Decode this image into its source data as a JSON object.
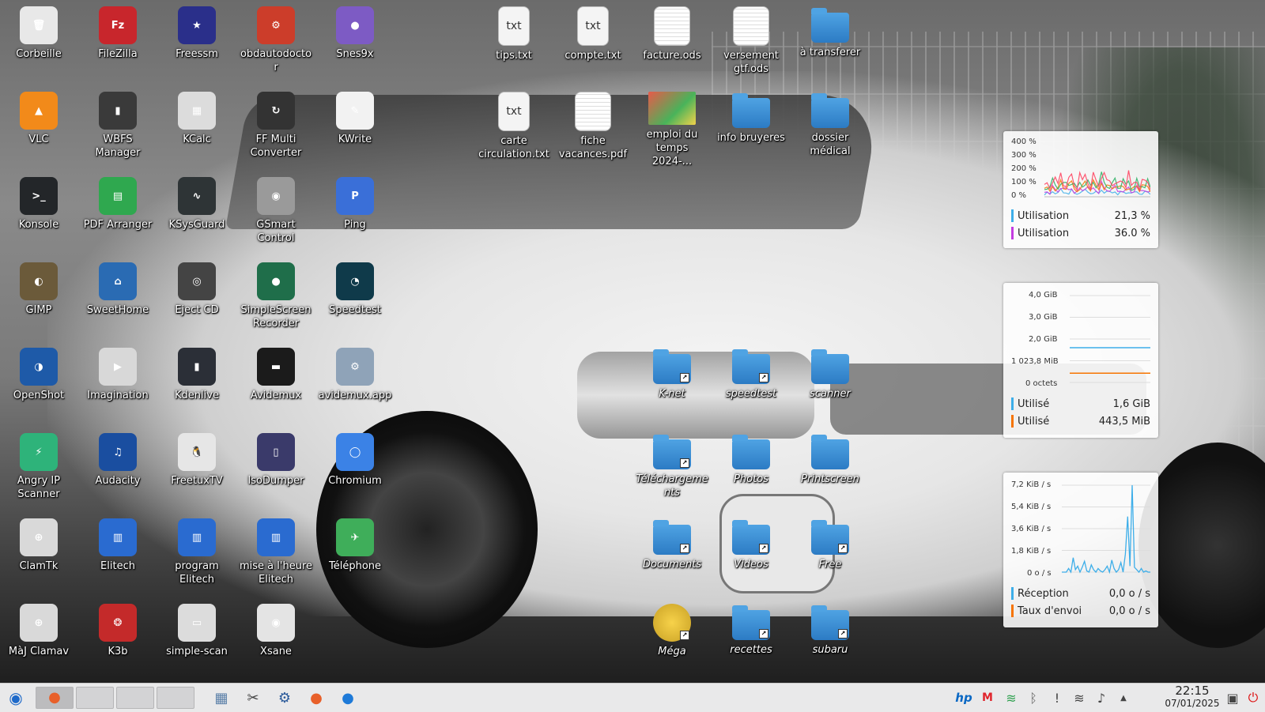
{
  "desktop": {
    "icons": [
      {
        "id": "corbeille",
        "label": "Corbeille",
        "icon": "trash-icon",
        "color": "#e8e8e8",
        "glyph": "🗑"
      },
      {
        "id": "filezilla",
        "label": "FileZilla",
        "icon": "filezilla-icon",
        "color": "#c8262c",
        "glyph": "Fz"
      },
      {
        "id": "freessm",
        "label": "Freessm",
        "icon": "freessm-icon",
        "color": "#2a2f8a",
        "glyph": "★"
      },
      {
        "id": "obdautodoctor",
        "label": "obdautodoctor",
        "icon": "engine-icon",
        "color": "#cc3d2a",
        "glyph": "⚙"
      },
      {
        "id": "snes9x",
        "label": "Snes9x",
        "icon": "gamepad-icon",
        "color": "#7d5bc4",
        "glyph": "●"
      },
      {
        "id": "vlc",
        "label": "VLC",
        "icon": "vlc-cone-icon",
        "color": "#f28a1a",
        "glyph": "▲"
      },
      {
        "id": "wbfs",
        "label": "WBFS Manager",
        "icon": "wbfs-icon",
        "color": "#3a3a3a",
        "glyph": "▮"
      },
      {
        "id": "kcalc",
        "label": "KCalc",
        "icon": "calculator-icon",
        "color": "#dcdcdc",
        "glyph": "▦"
      },
      {
        "id": "ffmulti",
        "label": "FF Multi Converter",
        "icon": "converter-icon",
        "color": "#333",
        "glyph": "↻"
      },
      {
        "id": "kwrite",
        "label": "KWrite",
        "icon": "pencil-icon",
        "color": "#f2f2f2",
        "glyph": "✎"
      },
      {
        "id": "konsole",
        "label": "Konsole",
        "icon": "terminal-icon",
        "color": "#232629",
        "glyph": ">_"
      },
      {
        "id": "pdfarranger",
        "label": "PDF Arranger",
        "icon": "pdf-arranger-icon",
        "color": "#2fa84f",
        "glyph": "▤"
      },
      {
        "id": "ksysguard",
        "label": "KSysGuard",
        "icon": "monitor-icon",
        "color": "#2e3436",
        "glyph": "∿"
      },
      {
        "id": "gsmart",
        "label": "GSmart Control",
        "icon": "hard-drive-icon",
        "color": "#9a9a9a",
        "glyph": "◉"
      },
      {
        "id": "ping",
        "label": "Ping",
        "icon": "ping-icon",
        "color": "#3a6fd8",
        "glyph": "P"
      },
      {
        "id": "gimp",
        "label": "GIMP",
        "icon": "gimp-icon",
        "color": "#6b5a3a",
        "glyph": "◐"
      },
      {
        "id": "sweethome",
        "label": "SweetHome",
        "icon": "house-icon",
        "color": "#2a6bb3",
        "glyph": "⌂"
      },
      {
        "id": "ejectcd",
        "label": "Eject CD",
        "icon": "cd-icon",
        "color": "#444",
        "glyph": "◎"
      },
      {
        "id": "simplescreen",
        "label": "SimpleScreen Recorder",
        "icon": "recorder-icon",
        "color": "#1f6e4a",
        "glyph": "●"
      },
      {
        "id": "speedtest",
        "label": "Speedtest",
        "icon": "speedometer-icon",
        "color": "#0f3a4a",
        "glyph": "◔"
      },
      {
        "id": "openshot",
        "label": "OpenShot",
        "icon": "openshot-icon",
        "color": "#1e5aa8",
        "glyph": "◑"
      },
      {
        "id": "imagination",
        "label": "Imagination",
        "icon": "imagination-icon",
        "color": "#d8d8d8",
        "glyph": "▶"
      },
      {
        "id": "kdenlive",
        "label": "Kdenlive",
        "icon": "kdenlive-icon",
        "color": "#2b2f37",
        "glyph": "▮"
      },
      {
        "id": "avidemux",
        "label": "Avidemux",
        "icon": "clapperboard-icon",
        "color": "#1b1b1b",
        "glyph": "▬"
      },
      {
        "id": "avidemuxapp",
        "label": "avidemux.app",
        "icon": "gear-play-icon",
        "color": "#8fa3b8",
        "glyph": "⚙"
      },
      {
        "id": "angryip",
        "label": "Angry IP Scanner",
        "icon": "lightning-icon",
        "color": "#2eb37a",
        "glyph": "⚡"
      },
      {
        "id": "audacity",
        "label": "Audacity",
        "icon": "headphones-icon",
        "color": "#1a4ea0",
        "glyph": "♫"
      },
      {
        "id": "freetuxtv",
        "label": "FreetuxTV",
        "icon": "tux-tv-icon",
        "color": "#e6e6e6",
        "glyph": "🐧"
      },
      {
        "id": "isodumper",
        "label": "IsoDumper",
        "icon": "usb-drive-icon",
        "color": "#3a3a6a",
        "glyph": "▯"
      },
      {
        "id": "chromium",
        "label": "Chromium",
        "icon": "chromium-icon",
        "color": "#3b82e6",
        "glyph": "◯"
      },
      {
        "id": "clamtk",
        "label": "ClamTk",
        "icon": "clam-icon",
        "color": "#d9d9d9",
        "glyph": "⊕"
      },
      {
        "id": "elitech",
        "label": "Elitech",
        "icon": "device-icon",
        "color": "#2a6bd0",
        "glyph": "▥"
      },
      {
        "id": "programelitech",
        "label": "program Elitech",
        "icon": "device-icon",
        "color": "#2a6bd0",
        "glyph": "▥"
      },
      {
        "id": "miseheure",
        "label": "mise à l'heure Elitech",
        "icon": "device-icon",
        "color": "#2a6bd0",
        "glyph": "▥"
      },
      {
        "id": "telephone",
        "label": "Téléphone",
        "icon": "paper-plane-icon",
        "color": "#3fae5a",
        "glyph": "✈"
      },
      {
        "id": "majclamav",
        "label": "MàJ Clamav",
        "icon": "clam-update-icon",
        "color": "#d9d9d9",
        "glyph": "⊕"
      },
      {
        "id": "k3b",
        "label": "K3b",
        "icon": "k3b-flame-icon",
        "color": "#c42a2a",
        "glyph": "❂"
      },
      {
        "id": "simplescan",
        "label": "simple-scan",
        "icon": "scanner-icon",
        "color": "#dcdcdc",
        "glyph": "▭"
      },
      {
        "id": "xsane",
        "label": "Xsane",
        "icon": "xsane-icon",
        "color": "#e4e4e4",
        "glyph": "◉"
      }
    ],
    "files": [
      {
        "id": "tips",
        "label": "tips.txt",
        "icon": "text-file-icon",
        "kind": "doc",
        "glyph": "txt"
      },
      {
        "id": "compte",
        "label": "compte.txt",
        "icon": "text-file-icon",
        "kind": "doc",
        "glyph": "txt"
      },
      {
        "id": "facture",
        "label": "facture.ods",
        "icon": "spreadsheet-icon",
        "kind": "sheet",
        "glyph": ""
      },
      {
        "id": "versement",
        "label": "versement gtf.ods",
        "icon": "spreadsheet-icon",
        "kind": "sheet",
        "glyph": ""
      },
      {
        "id": "atransferer",
        "label": "à transferer",
        "icon": "folder-icon",
        "kind": "folder",
        "glyph": ""
      },
      {
        "id": "carte",
        "label": "carte circulation.txt",
        "icon": "text-file-icon",
        "kind": "doc",
        "glyph": "txt"
      },
      {
        "id": "fiche",
        "label": "fiche vacances.pdf",
        "icon": "pdf-file-icon",
        "kind": "sheet",
        "glyph": ""
      },
      {
        "id": "emploi",
        "label": "emploi du temps 2024-...",
        "icon": "image-file-icon",
        "kind": "img",
        "glyph": ""
      },
      {
        "id": "infobruyeres",
        "label": "info bruyeres",
        "icon": "folder-icon",
        "kind": "folder",
        "glyph": ""
      },
      {
        "id": "dossiermedical",
        "label": "dossier médical",
        "icon": "folder-icon",
        "kind": "folder",
        "glyph": ""
      }
    ],
    "links": [
      {
        "id": "knet",
        "label": "K-net",
        "icon": "folder-link-icon"
      },
      {
        "id": "speedtestf",
        "label": "speedtest",
        "icon": "folder-link-icon"
      },
      {
        "id": "scanner",
        "label": "scanner",
        "icon": "folder-icon"
      },
      {
        "id": "telechargements",
        "label": "Téléchargements",
        "icon": "downloads-folder-icon"
      },
      {
        "id": "photos",
        "label": "Photos",
        "icon": "folder-icon"
      },
      {
        "id": "printscreen",
        "label": "Printscreen",
        "icon": "folder-icon"
      },
      {
        "id": "documents",
        "label": "Documents",
        "icon": "folder-link-icon"
      },
      {
        "id": "videos",
        "label": "Videos",
        "icon": "folder-link-icon"
      },
      {
        "id": "free",
        "label": "Free",
        "icon": "folder-link-icon"
      },
      {
        "id": "mega",
        "label": "Méga",
        "icon": "mega-folder-icon"
      },
      {
        "id": "recettes",
        "label": "recettes",
        "icon": "folder-link-icon"
      },
      {
        "id": "subaru",
        "label": "subaru",
        "icon": "folder-link-icon"
      }
    ]
  },
  "widgets": {
    "cpu": {
      "ticks": [
        "400 %",
        "300 %",
        "200 %",
        "100 %",
        "0 %"
      ],
      "rows": [
        {
          "label": "Utilisation",
          "value": "21,3 %",
          "color": "#3daee9"
        },
        {
          "label": "Utilisation",
          "value": "36.0 %",
          "color": "#c33be0"
        }
      ],
      "series_colors": [
        "#3daee9",
        "#c33be0",
        "#f67400",
        "#27ae60",
        "#ff3c5a"
      ],
      "chart_data": {
        "type": "area",
        "ylim": [
          0,
          400
        ],
        "values": [
          60,
          80,
          55,
          120,
          90,
          70,
          150,
          85,
          100,
          95,
          130,
          75,
          60,
          110,
          90,
          140,
          100,
          80,
          120,
          95,
          70,
          160,
          110,
          90,
          100,
          85,
          130,
          70,
          90,
          100,
          80,
          120,
          60,
          90,
          110,
          70,
          85,
          95,
          100,
          60
        ]
      }
    },
    "memory": {
      "ticks": [
        "4,0 GiB",
        "3,0 GiB",
        "2,0 GiB",
        "1 023,8 MiB",
        "0 octets"
      ],
      "rows": [
        {
          "label": "Utilisé",
          "value": "1,6 GiB",
          "color": "#3daee9"
        },
        {
          "label": "Utilisé",
          "value": "443,5 MiB",
          "color": "#f67400"
        }
      ],
      "chart_data": {
        "type": "line",
        "ylim": [
          0,
          4
        ],
        "series": [
          {
            "values": [
              1.6,
              1.6,
              1.6,
              1.6,
              1.6,
              1.6,
              1.6,
              1.6,
              1.6,
              1.6
            ]
          },
          {
            "values": [
              0.43,
              0.43,
              0.43,
              0.43,
              0.43,
              0.43,
              0.43,
              0.43,
              0.43,
              0.43
            ]
          }
        ]
      }
    },
    "network": {
      "ticks": [
        "7,2 KiB / s",
        "5,4 KiB / s",
        "3,6 KiB / s",
        "1,8 KiB / s",
        "0 o / s"
      ],
      "rows": [
        {
          "label": "Réception",
          "value": "0,0 o / s",
          "color": "#3daee9"
        },
        {
          "label": "Taux d'envoi",
          "value": "0,0 o / s",
          "color": "#f67400"
        }
      ],
      "chart_data": {
        "type": "line",
        "ylim": [
          0,
          7.2
        ],
        "values": [
          0,
          0,
          0,
          0.3,
          0,
          1.2,
          0.2,
          0.5,
          0,
          0.4,
          0.9,
          0.1,
          0,
          0.6,
          0.2,
          0,
          0.3,
          0.1,
          0,
          0.2,
          0.5,
          0,
          1.0,
          0.3,
          0,
          0.2,
          0.8,
          0,
          1.5,
          4.6,
          0.5,
          7.2,
          0.4,
          0.2,
          0,
          0.3,
          0,
          0.1,
          0,
          0
        ]
      }
    }
  },
  "taskbar": {
    "launcher_icon": "kde-launcher-icon",
    "tasks": [
      {
        "name": "firefox-task",
        "active": true
      },
      {
        "name": "task-2",
        "active": false
      },
      {
        "name": "task-3",
        "active": false
      },
      {
        "name": "task-4",
        "active": false
      }
    ],
    "quicklaunch": [
      {
        "name": "calculator-launcher",
        "icon": "calculator-icon",
        "glyph": "▦"
      },
      {
        "name": "tools-launcher",
        "icon": "tools-icon",
        "glyph": "✂"
      },
      {
        "name": "settings-launcher",
        "icon": "settings-icon",
        "glyph": "⚙"
      },
      {
        "name": "firefox-launcher",
        "icon": "firefox-icon",
        "glyph": "●"
      },
      {
        "name": "thunderbird-launcher",
        "icon": "thunderbird-icon",
        "glyph": "●"
      }
    ],
    "tray": [
      {
        "name": "hp-tray",
        "icon": "hp-icon",
        "glyph": "hp",
        "color": "#0a68c4"
      },
      {
        "name": "mega-tray",
        "icon": "mega-icon",
        "glyph": "M",
        "color": "#e0242c"
      },
      {
        "name": "wifi-tray",
        "icon": "wifi-icon",
        "glyph": "≋",
        "color": "#2ea04f"
      },
      {
        "name": "bluetooth-tray",
        "icon": "bluetooth-icon",
        "glyph": "ᛒ",
        "color": "#666"
      },
      {
        "name": "notification-tray",
        "icon": "notification-icon",
        "glyph": "!",
        "color": "#444"
      },
      {
        "name": "network-tray",
        "icon": "network-icon",
        "glyph": "≋",
        "color": "#444"
      },
      {
        "name": "volume-tray",
        "icon": "volume-icon",
        "glyph": "♪",
        "color": "#444"
      },
      {
        "name": "expand-tray",
        "icon": "chevron-up-icon",
        "glyph": "▲",
        "color": "#444"
      }
    ],
    "clock": {
      "time": "22:15",
      "date": "07/01/2025"
    },
    "lock_icon": "lock-screen-icon",
    "power_icon": "power-icon"
  }
}
